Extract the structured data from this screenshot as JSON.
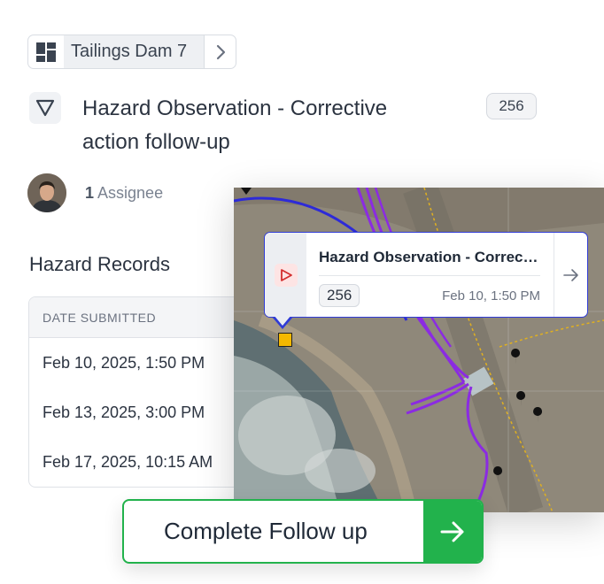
{
  "breadcrumb": {
    "icon": "dashboard-grid-icon",
    "label": "Tailings Dam 7",
    "chevron": "chevron-right-icon"
  },
  "header": {
    "type_icon": "triangle-down-icon",
    "title": "Hazard Observation - Corrective action follow-up",
    "count": "256"
  },
  "assignees": {
    "count": "1",
    "label": "Assignee"
  },
  "records": {
    "heading": "Hazard Records",
    "column": "DATE SUBMITTED",
    "rows": [
      "Feb 10, 2025, 1:50 PM",
      "Feb 13, 2025, 3:00 PM",
      "Feb 17, 2025, 10:15 AM"
    ]
  },
  "map_popup": {
    "icon": "play-triangle-icon",
    "title": "Hazard Observation - Correcti…",
    "count": "256",
    "date": "Feb 10, 1:50 PM",
    "arrow": "arrow-right-icon"
  },
  "cta": {
    "label": "Complete Follow up",
    "icon": "arrow-right-icon"
  },
  "colors": {
    "accent_green": "#22b24c",
    "popup_border": "#2f3bd6",
    "route_purple": "#8b2be2",
    "marker_yellow": "#f5b800"
  }
}
